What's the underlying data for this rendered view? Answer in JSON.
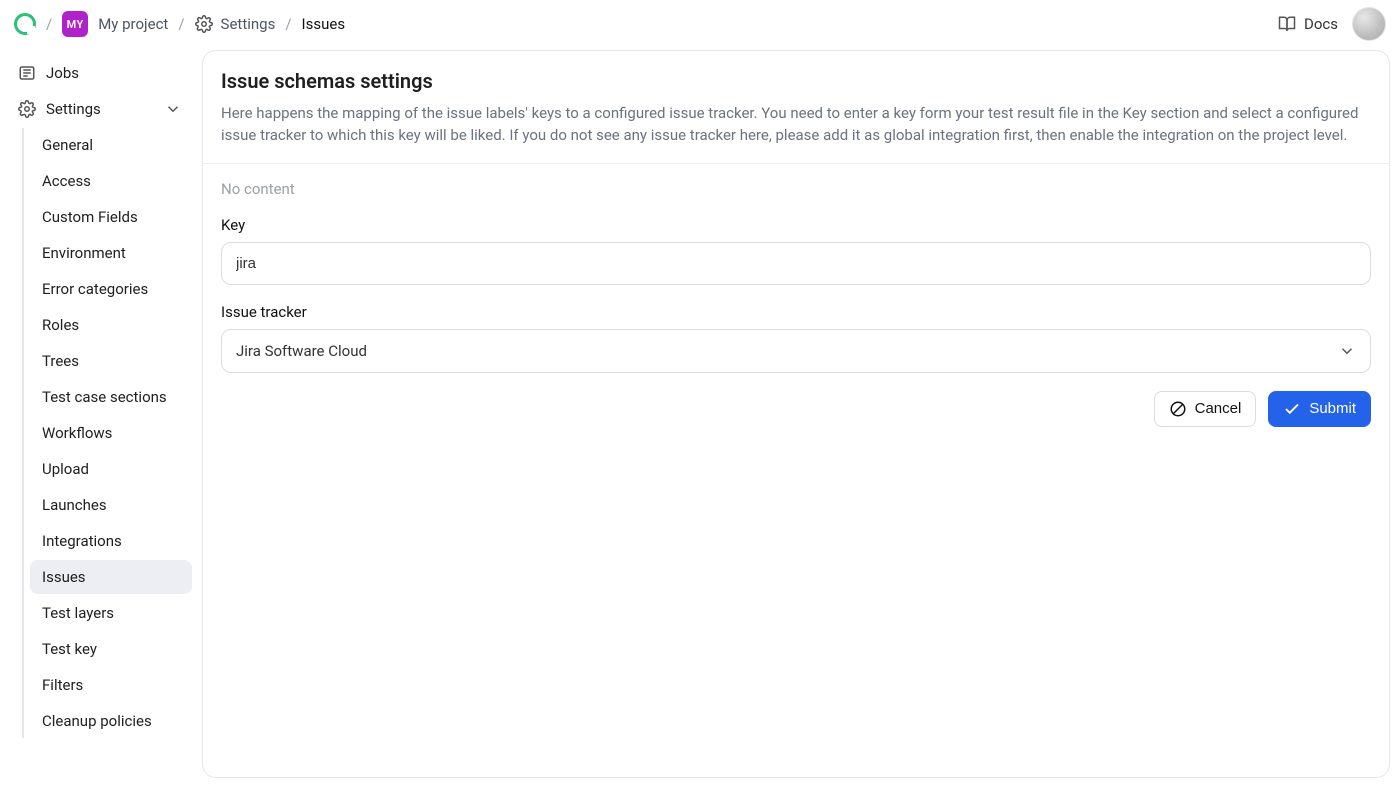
{
  "breadcrumb": {
    "project_badge": "MY",
    "project_name": "My project",
    "settings": "Settings",
    "current": "Issues"
  },
  "header": {
    "docs": "Docs"
  },
  "sidebar": {
    "jobs": "Jobs",
    "settings": "Settings",
    "items": [
      "General",
      "Access",
      "Custom Fields",
      "Environment",
      "Error categories",
      "Roles",
      "Trees",
      "Test case sections",
      "Workflows",
      "Upload",
      "Launches",
      "Integrations",
      "Issues",
      "Test layers",
      "Test key",
      "Filters",
      "Cleanup policies"
    ],
    "active_index": 12
  },
  "main": {
    "title": "Issue schemas settings",
    "description": "Here happens the mapping of the issue labels' keys to a configured issue tracker. You need to enter a key form your test result file in the Key section and select a configured issue tracker to which this key will be liked. If you do not see any issue tracker here, please add it as global integration first, then enable the integration on the project level.",
    "no_content": "No content",
    "key_label": "Key",
    "key_value": "jira",
    "tracker_label": "Issue tracker",
    "tracker_value": "Jira Software Cloud",
    "cancel": "Cancel",
    "submit": "Submit"
  }
}
